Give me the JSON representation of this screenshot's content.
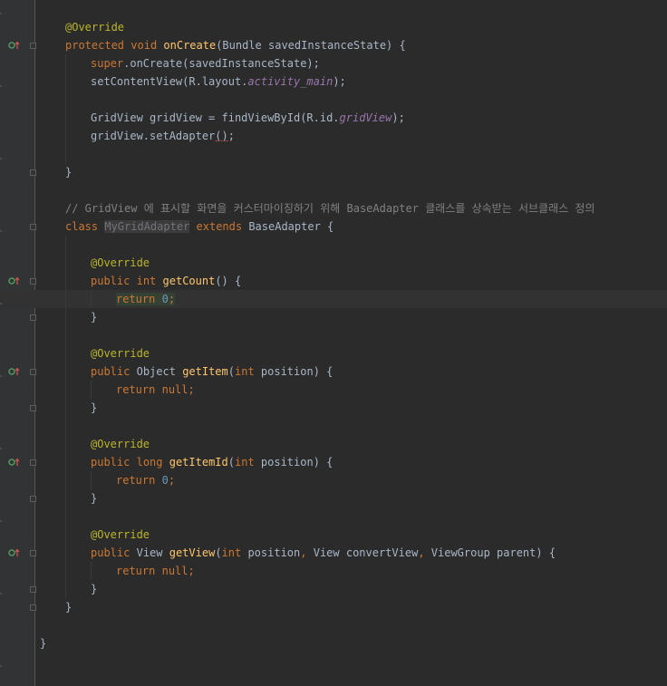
{
  "editor": {
    "line_override_1": "@Override",
    "line_oncreate": {
      "kw1": "protected",
      "kw2": "void",
      "name": "onCreate",
      "params": "(Bundle savedInstanceState) {"
    },
    "line_super": {
      "kw": "super",
      "rest": ".onCreate(savedInstanceState);"
    },
    "line_setcontent": {
      "pre": "setContentView(R.layout.",
      "field": "activity_main",
      "post": ");"
    },
    "line_gridview": {
      "pre": "GridView gridView = findViewById(R.id.",
      "field": "gridView",
      "post": ");"
    },
    "line_setadapter": {
      "pre": "gridView.setAdapter",
      "warn": "()",
      "post": ";"
    },
    "line_close_1": "}",
    "comment": "// GridView 에 표시할 화면을 커스터마이징하기 위해 BaseAdapter 클래스를 상속받는 서브클래스 정의",
    "line_class": {
      "kw1": "class",
      "name": "MyGridAdapter",
      "kw2": "extends",
      "rest": "BaseAdapter {"
    },
    "m1": {
      "ann": "@Override",
      "kw1": "public",
      "kw2": "int",
      "name": "getCount",
      "params": "() {",
      "ret_kw": "return",
      "ret_val": "0",
      "semi": ";",
      "close": "}"
    },
    "m2": {
      "ann": "@Override",
      "kw1": "public",
      "type": "Object",
      "name": "getItem",
      "po": "(",
      "pkw": "int",
      "pn": " position) {",
      "ret_kw": "return",
      "ret_val": "null",
      "semi": ";",
      "close": "}"
    },
    "m3": {
      "ann": "@Override",
      "kw1": "public",
      "kw2": "long",
      "name": "getItemId",
      "po": "(",
      "pkw": "int",
      "pn": " position) {",
      "ret_kw": "return",
      "ret_val": "0",
      "semi": ";",
      "close": "}"
    },
    "m4": {
      "ann": "@Override",
      "kw1": "public",
      "type": "View",
      "name": "getView",
      "po": "(",
      "pkw": "int",
      "pn": " position",
      "c1": ",",
      "p2": " View convertView",
      "c2": ",",
      "p3": " ViewGroup parent) {",
      "ret_kw": "return",
      "ret_val": "null",
      "semi": ";",
      "close": "}"
    },
    "line_close_class": "}",
    "line_close_outer": "}"
  },
  "colors": {
    "background": "#2b2b2b",
    "gutter": "#313335",
    "keyword": "#cc7832",
    "annotation": "#bbb529",
    "method": "#ffc66d",
    "number": "#6897bb",
    "field": "#9876aa",
    "comment": "#808080",
    "override_icon": "#4e9a5f"
  },
  "gutter_icons": [
    "override-method-icon",
    "implement-method-icon"
  ]
}
